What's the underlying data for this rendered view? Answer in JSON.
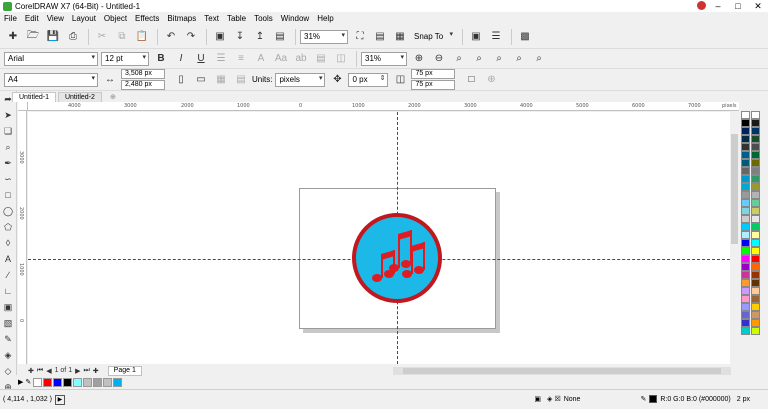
{
  "window": {
    "title": "CorelDRAW X7 (64-Bit) - Untitled-1"
  },
  "menu": [
    "File",
    "Edit",
    "View",
    "Layout",
    "Object",
    "Effects",
    "Bitmaps",
    "Text",
    "Table",
    "Tools",
    "Window",
    "Help"
  ],
  "toolbar": {
    "zoom": "31%",
    "snap_to": "Snap To"
  },
  "text_bar": {
    "font": "Arial",
    "size": "12 pt",
    "zoom2": "31%"
  },
  "property_bar": {
    "page_size": "A4",
    "width": "3,508 px",
    "height": "2,480 px",
    "units_label": "Units:",
    "units": "pixels",
    "nudge": "0 px",
    "dup_x": "75 px",
    "dup_y": "75 px"
  },
  "doc_tabs": [
    "Untitled-1",
    "Untitled-2"
  ],
  "ruler_h": [
    "4000",
    "3000",
    "2000",
    "1000",
    "0",
    "1000",
    "2000",
    "3000",
    "4000",
    "5000",
    "6000",
    "7000",
    "pixels"
  ],
  "ruler_v": [
    "3000",
    "2000",
    "1000",
    "0",
    "1000",
    "2000"
  ],
  "page_nav": {
    "count": "1 of 1",
    "page_tab": "Page 1"
  },
  "artwork": {
    "circle_fill": "#1bb8e8",
    "circle_stroke": "#c0181e",
    "notes_fill": "#e11b22"
  },
  "doc_palette": [
    "#ff0000",
    "#0000ff",
    "#000000",
    "#7fffff",
    "#c0c0c0",
    "#a0a0a0",
    "#c0c0c0",
    "#00b0f0"
  ],
  "palette": [
    "#000000",
    "#1a1a1a",
    "#00205b",
    "#003366",
    "#002c4a",
    "#1c4a2c",
    "#333333",
    "#4d4d4d",
    "#005f8a",
    "#006633",
    "#005a7a",
    "#6a6a00",
    "#666666",
    "#808080",
    "#0099cc",
    "#339966",
    "#00aacc",
    "#999933",
    "#999999",
    "#b3b3b3",
    "#66ccff",
    "#66cc99",
    "#7fd4e0",
    "#cccc66",
    "#cccccc",
    "#e6e6e6",
    "#00ccff",
    "#00cc66",
    "#aaf0ff",
    "#ffff99",
    "#0000ff",
    "#00ffff",
    "#00ff00",
    "#ffff00",
    "#ff00ff",
    "#ff0000",
    "#9900cc",
    "#ff6600",
    "#cc3399",
    "#993300",
    "#ff9933",
    "#663300",
    "#cc99ff",
    "#ffcc99",
    "#ff99cc",
    "#996633",
    "#9999ff",
    "#ffcc00",
    "#6666cc",
    "#cc9966",
    "#3333cc",
    "#ff9900",
    "#00cccc",
    "#ccff00"
  ],
  "status": {
    "coords": "( 4,114 , 1,032 )",
    "fill_none": "None",
    "outline_info": "R:0 G:0 B:0 (#000000)",
    "outline_width": "2 px"
  }
}
